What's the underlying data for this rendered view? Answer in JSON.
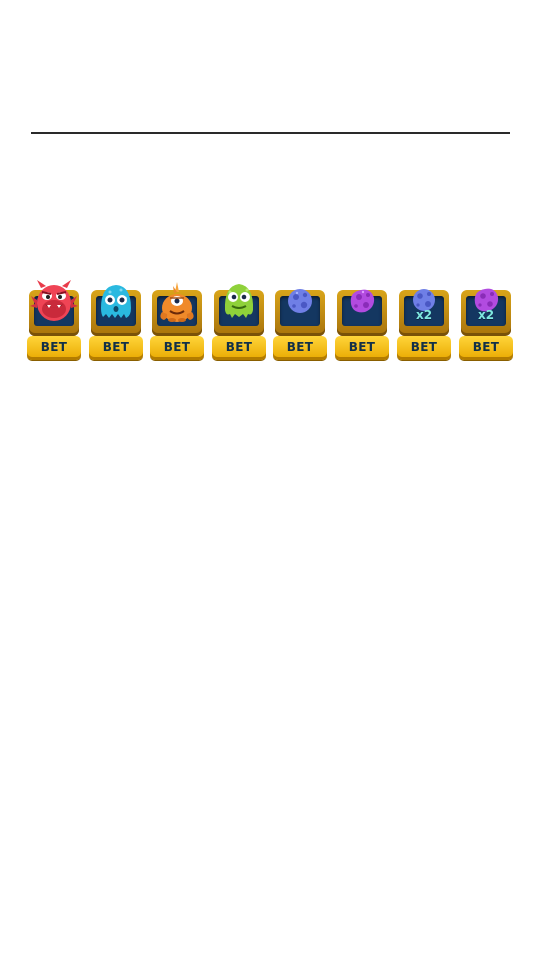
{
  "slots": [
    {
      "icon": "red-monster-icon",
      "bet_label": "BET",
      "multiplier": ""
    },
    {
      "icon": "blue-monster-icon",
      "bet_label": "BET",
      "multiplier": ""
    },
    {
      "icon": "orange-monster-icon",
      "bet_label": "BET",
      "multiplier": ""
    },
    {
      "icon": "green-monster-icon",
      "bet_label": "BET",
      "multiplier": ""
    },
    {
      "icon": "blue-meteor-icon",
      "bet_label": "BET",
      "multiplier": ""
    },
    {
      "icon": "purple-meteor-icon",
      "bet_label": "BET",
      "multiplier": ""
    },
    {
      "icon": "blue-meteor-icon",
      "bet_label": "BET",
      "multiplier": "x2"
    },
    {
      "icon": "purple-meteor-icon",
      "bet_label": "BET",
      "multiplier": "x2"
    }
  ],
  "colors": {
    "pedestal": "#d9a51a",
    "screen": "#143761",
    "bet_button": "#ffd53a",
    "bet_text": "#123048",
    "multiplier_text": "#7fe8e0"
  }
}
